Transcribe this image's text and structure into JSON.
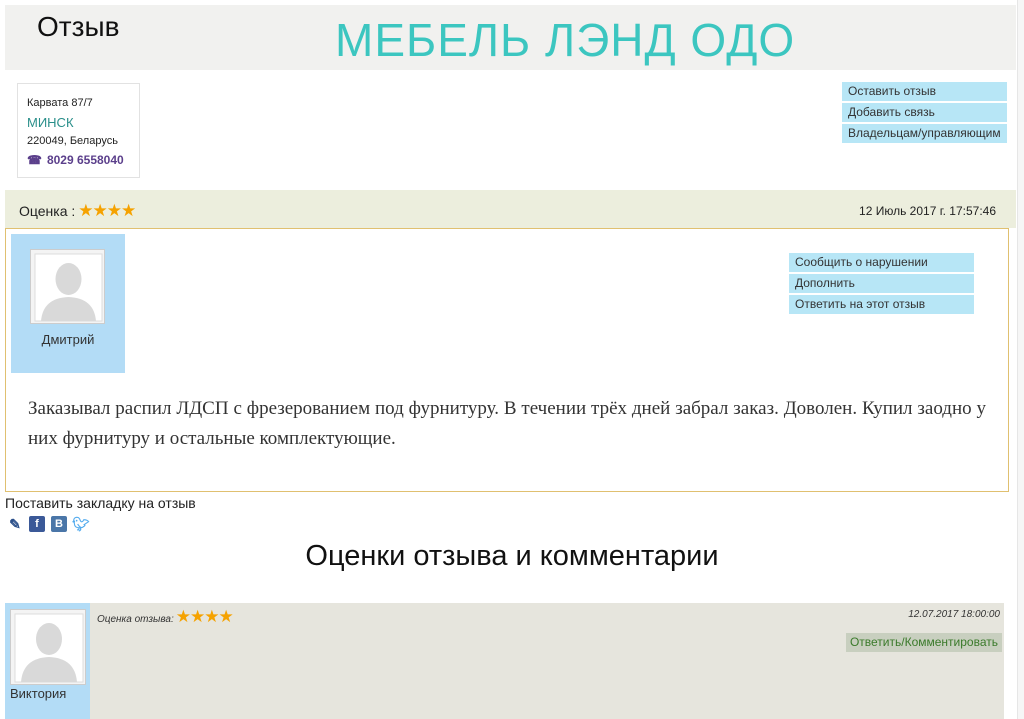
{
  "header": {
    "review_word": "Отзыв",
    "company": "МЕБЕЛЬ ЛЭНД ОДО"
  },
  "address": {
    "street": "Карвата 87/7",
    "city": "МИНСК",
    "postal": "220049, Беларусь",
    "phone": "8029 6558040",
    "phone_icon": "phone-icon"
  },
  "side_links": [
    "Оставить отзыв",
    "Добавить связь",
    "Владельцам/управляющим"
  ],
  "rating": {
    "label": "Оценка :",
    "stars": "★★★★",
    "date": "12 Июль 2017 г. 17:57:46"
  },
  "review": {
    "author": "Дмитрий",
    "links": [
      "Сообщить о нарушении",
      "Дополнить",
      "Ответить на этот отзыв"
    ],
    "text": "Заказывал распил ЛДСП с фрезерованием под фурнитуру. В течении трёх дней забрал заказ. Доволен. Купил заодно у них фурнитуру и остальные комплектующие."
  },
  "bookmark": {
    "label": "Поставить закладку на отзыв",
    "icons": [
      "bookmark-icon",
      "facebook-icon",
      "vk-icon",
      "twitter-icon"
    ],
    "fb": "f",
    "vk": "B"
  },
  "comments": {
    "heading": "Оценки отзыва и комментарии",
    "items": [
      {
        "author": "Виктория",
        "rating_label": "Оценка отзыва:",
        "stars": "★★★★",
        "date": "12.07.2017 18:00:00",
        "reply": "Ответить/Комментировать"
      }
    ]
  },
  "colors": {
    "brand": "#3cc6c0",
    "link_bg": "#b7e6f6",
    "star": "#f5a200",
    "rating_bar": "#eceedd",
    "review_border": "#e0c070",
    "author_bg": "#b3dcf6"
  }
}
